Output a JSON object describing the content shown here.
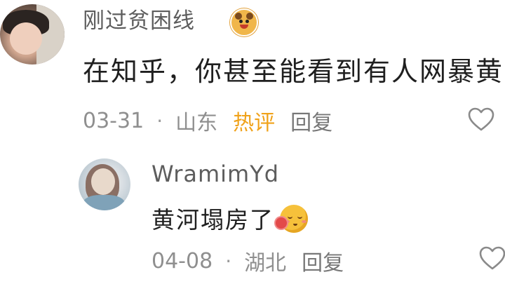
{
  "comment": {
    "username": "刚过贫困线",
    "content": "在知乎，你甚至能看到有人网暴黄",
    "date": "03-31",
    "location": "山东",
    "hot_tag": "热评",
    "reply_label": "回复",
    "separator": "·"
  },
  "reply": {
    "username": "WramimYd",
    "content": "黄河塌房了",
    "date": "04-08",
    "location": "湖北",
    "reply_label": "回复",
    "separator": "·"
  },
  "colors": {
    "hot_tag": "#f0a21a",
    "meta_text": "#8f8f8f",
    "body_text": "#1f1f1f",
    "username": "#5d5d5d"
  },
  "icons": {
    "badge": "cartoon-tiger-badge-icon",
    "like": "heart-outline-icon",
    "emoji": "shy-smile-flower-emoji"
  }
}
